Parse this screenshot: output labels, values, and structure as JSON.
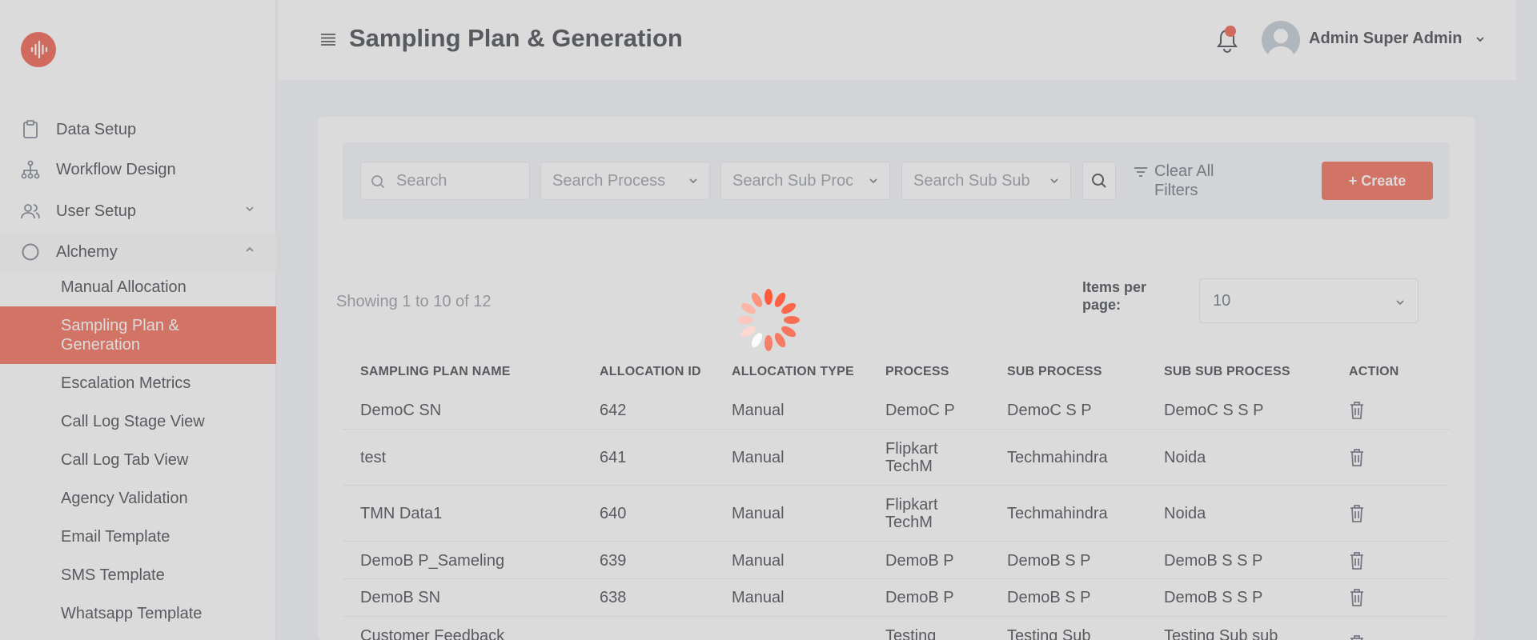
{
  "app": {
    "page_title": "Sampling Plan & Generation",
    "user_name": "Admin Super Admin",
    "accent_color": "#f15a42",
    "loading": true
  },
  "sidebar": {
    "items": [
      {
        "label": "Data Setup",
        "icon": "clipboard-icon"
      },
      {
        "label": "Workflow Design",
        "icon": "hierarchy-icon"
      },
      {
        "label": "User Setup",
        "icon": "users-icon",
        "expandable": true
      },
      {
        "label": "Alchemy",
        "icon": "circle-icon",
        "expanded": true
      }
    ],
    "sub_items": [
      {
        "label": "Manual Allocation"
      },
      {
        "label": "Sampling Plan & Generation",
        "active": true
      },
      {
        "label": "Escalation Metrics"
      },
      {
        "label": "Call Log Stage View"
      },
      {
        "label": "Call Log Tab View"
      },
      {
        "label": "Agency Validation"
      },
      {
        "label": "Email Template"
      },
      {
        "label": "SMS Template"
      },
      {
        "label": "Whatsapp Template"
      }
    ]
  },
  "filters": {
    "search_placeholder": "Search",
    "process_placeholder": "Search Process",
    "sub_process_placeholder": "Search Sub Proc",
    "sub_sub_process_placeholder": "Search Sub Sub",
    "clear_line1": "Clear All",
    "clear_line2": "Filters",
    "create_label": "+ Create"
  },
  "pagination": {
    "showing": "Showing 1 to 10 of 12",
    "items_per_page_label": "Items per page:",
    "items_per_page": "10"
  },
  "table": {
    "headers": [
      "SAMPLING PLAN NAME",
      "ALLOCATION ID",
      "ALLOCATION TYPE",
      "PROCESS",
      "SUB PROCESS",
      "SUB SUB PROCESS",
      "ACTION"
    ],
    "rows": [
      {
        "name": "DemoC SN",
        "id": "642",
        "type": "Manual",
        "process": "DemoC P",
        "sub_process": "DemoC S P",
        "sub_sub_process": "DemoC S S P"
      },
      {
        "name": "test",
        "id": "641",
        "type": "Manual",
        "process": "Flipkart TechM",
        "sub_process": "Techmahindra",
        "sub_sub_process": "Noida"
      },
      {
        "name": "TMN Data1",
        "id": "640",
        "type": "Manual",
        "process": "Flipkart TechM",
        "sub_process": "Techmahindra",
        "sub_sub_process": "Noida"
      },
      {
        "name": "DemoB P_Sameling",
        "id": "639",
        "type": "Manual",
        "process": "DemoB P",
        "sub_process": "DemoB S P",
        "sub_sub_process": "DemoB S S P"
      },
      {
        "name": "DemoB SN",
        "id": "638",
        "type": "Manual",
        "process": "DemoB P",
        "sub_process": "DemoB S P",
        "sub_sub_process": "DemoB S S P"
      },
      {
        "name": "Customer Feedback",
        "id": "",
        "type": "",
        "process": "Testing",
        "sub_process": "Testing Sub",
        "sub_sub_process": "Testing Sub sub"
      }
    ]
  }
}
